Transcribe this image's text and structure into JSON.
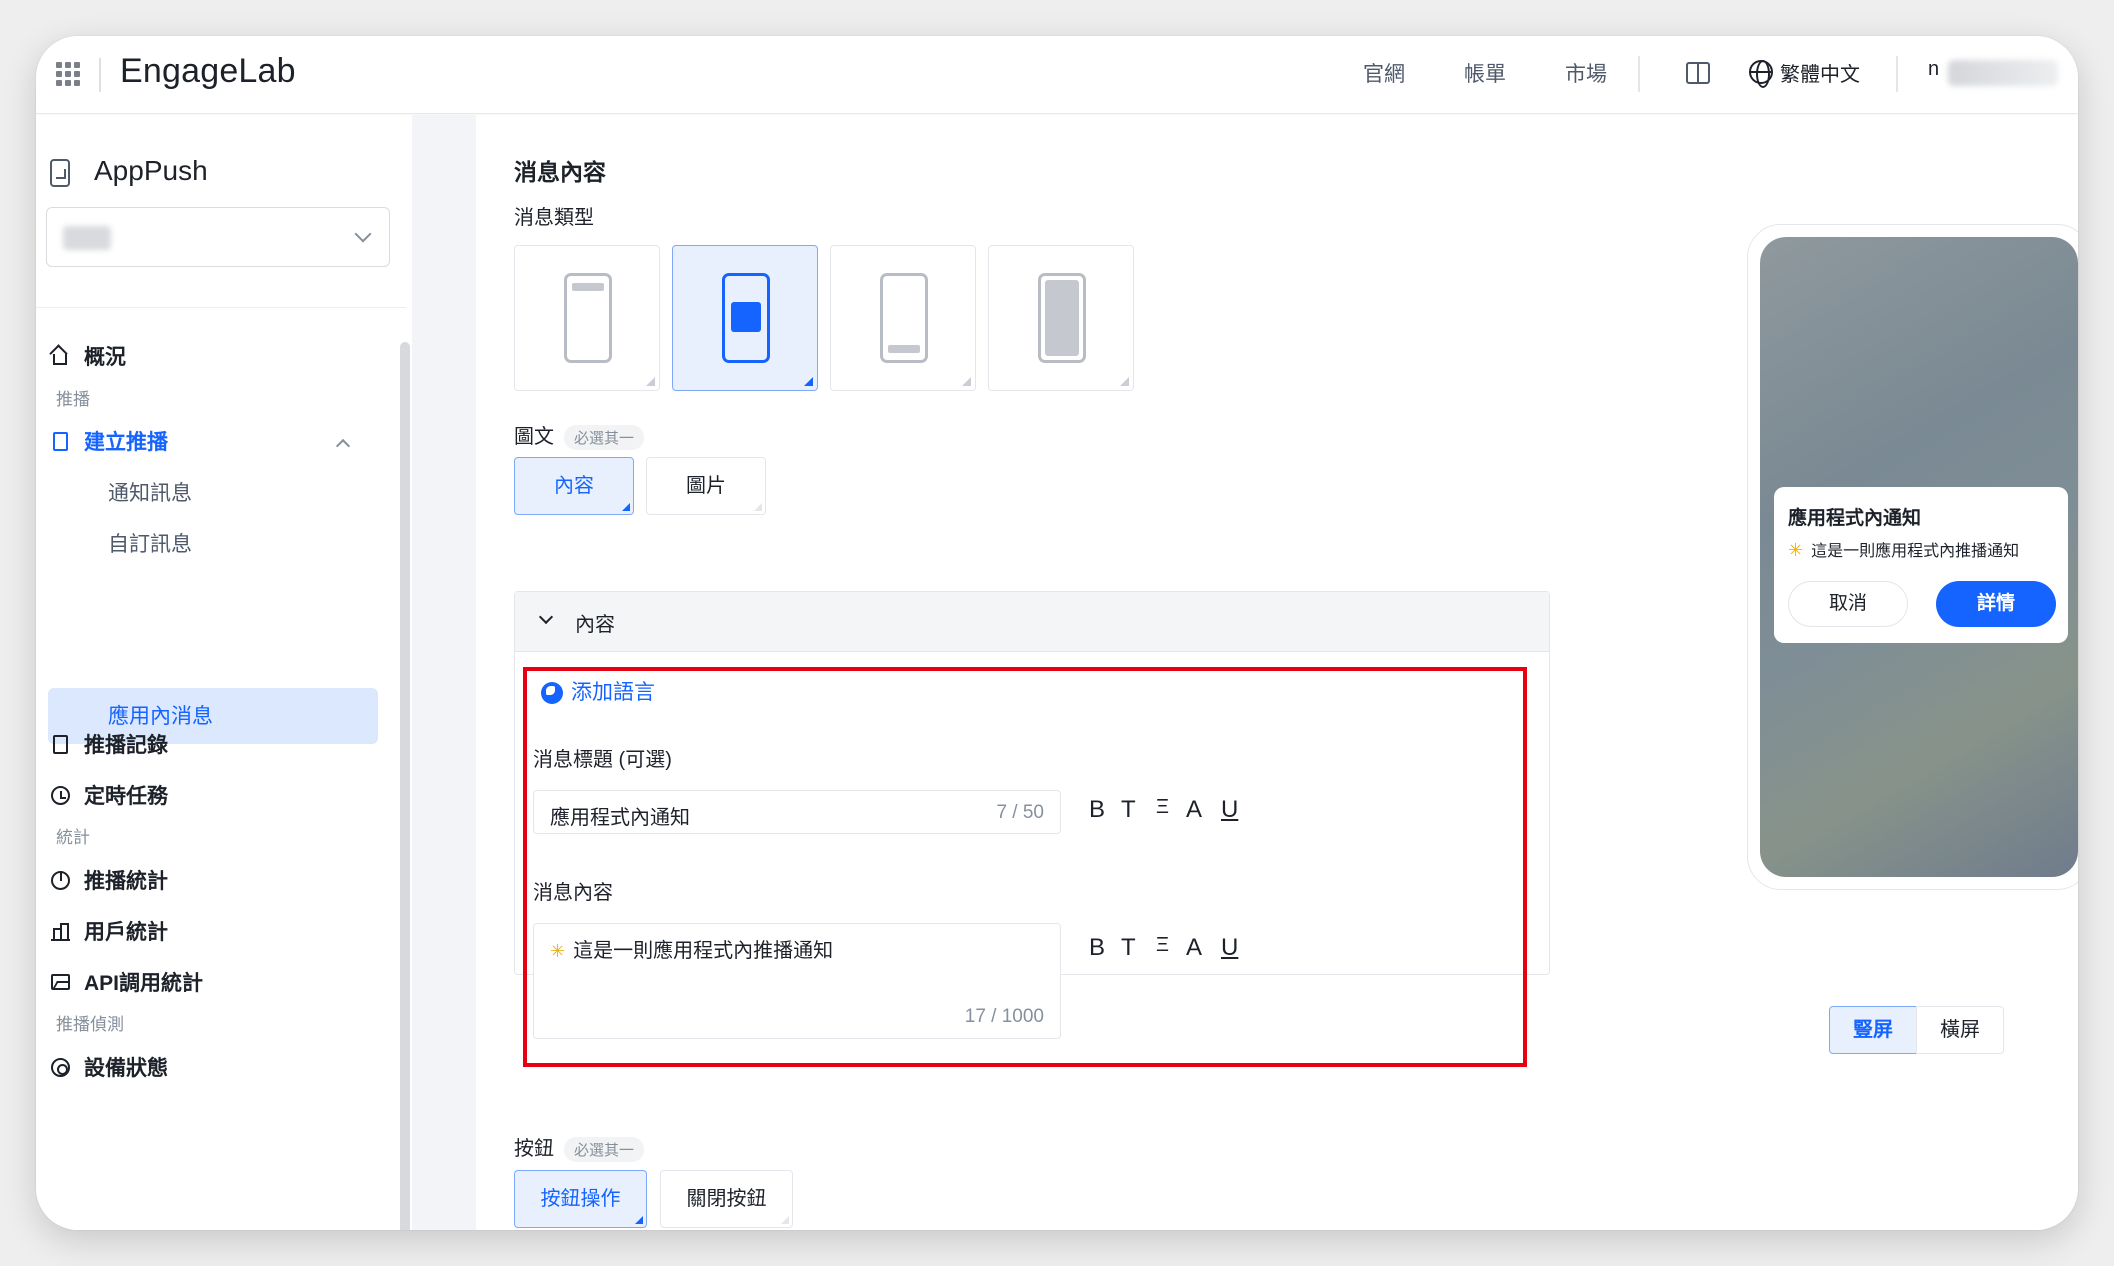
{
  "topbar": {
    "logo": "EngageLab",
    "nav": [
      "官網",
      "帳單",
      "市場"
    ],
    "language": "繁體中文",
    "user_initial": "n"
  },
  "sidebar": {
    "app_name": "AppPush",
    "groups": {
      "push": "推播",
      "stats": "統計",
      "detect": "推播偵測"
    },
    "items": {
      "overview": "概況",
      "create_push": "建立推播",
      "notification_msg": "通知訊息",
      "custom_msg": "自訂訊息",
      "in_app_msg": "應用內消息",
      "push_records": "推播記錄",
      "scheduled_tasks": "定時任務",
      "push_stats": "推播統計",
      "user_stats": "用戶統計",
      "api_stats": "API調用統計",
      "device_status": "設備狀態"
    }
  },
  "main": {
    "section_title": "消息內容",
    "message_type_label": "消息類型",
    "message_types": [
      "top-banner",
      "center-popup",
      "bottom-banner",
      "fullscreen"
    ],
    "selected_message_type": "center-popup",
    "image_text": {
      "label": "圖文",
      "required_tag": "必選其一",
      "options": [
        "內容",
        "圖片"
      ],
      "selected": "內容"
    },
    "content_panel": {
      "header": "內容",
      "add_language": "添加語言",
      "title_label": "消息標題 (可選)",
      "title_value": "應用程式內通知",
      "title_count": "7 / 50",
      "body_label": "消息內容",
      "body_value": "這是一則應用程式內推播通知",
      "body_count": "17 / 1000",
      "format_buttons": [
        "B",
        "T",
        "Ξ",
        "A",
        "U"
      ]
    },
    "buttons": {
      "label": "按鈕",
      "required_tag": "必選其一",
      "options": [
        "按鈕操作",
        "關閉按鈕"
      ],
      "selected": "按鈕操作"
    }
  },
  "preview": {
    "title": "應用程式內通知",
    "body": "這是一則應用程式內推播通知",
    "cancel": "取消",
    "detail": "詳情",
    "orientation": [
      "豎屏",
      "橫屏"
    ],
    "selected_orientation": "豎屏"
  },
  "colors": {
    "accent": "#1664ff",
    "highlight_border": "#e60012"
  }
}
